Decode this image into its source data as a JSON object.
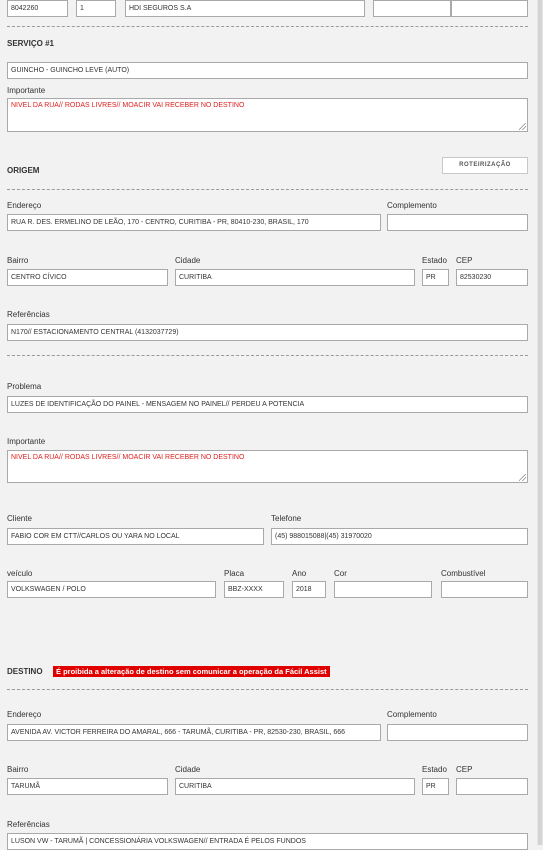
{
  "top_row": {
    "field1": "8042260",
    "field2": "1",
    "field3": "HDI SEGUROS S.A",
    "field4": "",
    "field5": ""
  },
  "servico": {
    "heading": "SERVIÇO #1",
    "service_value": "GUINCHO - GUINCHO LEVE (AUTO)",
    "importante_label": "Importante",
    "importante_value": "NIVEL DA RUA// RODAS LIVRES//  MOACIR VAI RECEBER NO DESTINO"
  },
  "origem": {
    "heading": "ORIGEM",
    "routing_button": "ROTEIRIZAÇÃO",
    "endereco_label": "Endereço",
    "endereco_value": "RUA R. DES. ERMELINO DE LEÃO, 170 - CENTRO, CURITIBA - PR, 80410-230, BRASIL, 170",
    "complemento_label": "Complemento",
    "complemento_value": "",
    "bairro_label": "Bairro",
    "bairro_value": "CENTRO CÍVICO",
    "cidade_label": "Cidade",
    "cidade_value": "CURITIBA",
    "estado_label": "Estado",
    "estado_value": "PR",
    "cep_label": "CEP",
    "cep_value": "82530230",
    "referencias_label": "Referências",
    "referencias_value": "N170// ESTACIONAMENTO CENTRAL (4132037729)"
  },
  "problema": {
    "problema_label": "Problema",
    "problema_value": "LUZES DE IDENTIFICAÇÃO DO PAINEL - MENSAGEM NO PAINEL// PERDEU A POTENCIA",
    "importante_label": "Importante",
    "importante_value": "NIVEL DA RUA// RODAS LIVRES//  MOACIR VAI RECEBER NO DESTINO",
    "cliente_label": "Cliente",
    "cliente_value": "FABIO COR EM CTT//CARLOS OU YARA NO LOCAL",
    "telefone_label": "Telefone",
    "telefone_value": "(45) 988015088|(45) 31970020",
    "veiculo_label": "veículo",
    "veiculo_value": "VOLKSWAGEN / POLO",
    "placa_label": "Placa",
    "placa_value": "BBZ-XXXX",
    "ano_label": "Ano",
    "ano_value": "2018",
    "cor_label": "Cor",
    "cor_value": "",
    "combustivel_label": "Combustível",
    "combustivel_value": ""
  },
  "destino": {
    "heading": "DESTINO",
    "warning": "É proibida a alteração de destino sem comunicar a operação da Fácil Assist",
    "endereco_label": "Endereço",
    "endereco_value": "AVENIDA AV. VICTOR FERREIRA DO AMARAL, 666 - TARUMÃ, CURITIBA - PR, 82530-230, BRASIL, 666",
    "complemento_label": "Complemento",
    "complemento_value": "",
    "bairro_label": "Bairro",
    "bairro_value": "TARUMÃ",
    "cidade_label": "Cidade",
    "cidade_value": "CURITIBA",
    "estado_label": "Estado",
    "estado_value": "PR",
    "cep_label": "CEP",
    "cep_value": "",
    "referencias_label": "Referências",
    "referencias_value": "LUSON VW - TARUMÃ | CONCESSIONÁRIA VOLKSWAGEN// ENTRADA É PELOS FUNDOS"
  },
  "colors": {
    "warning_bg": "#e00000",
    "importante_text": "#e02020",
    "page_bg": "#f2f2f2"
  }
}
